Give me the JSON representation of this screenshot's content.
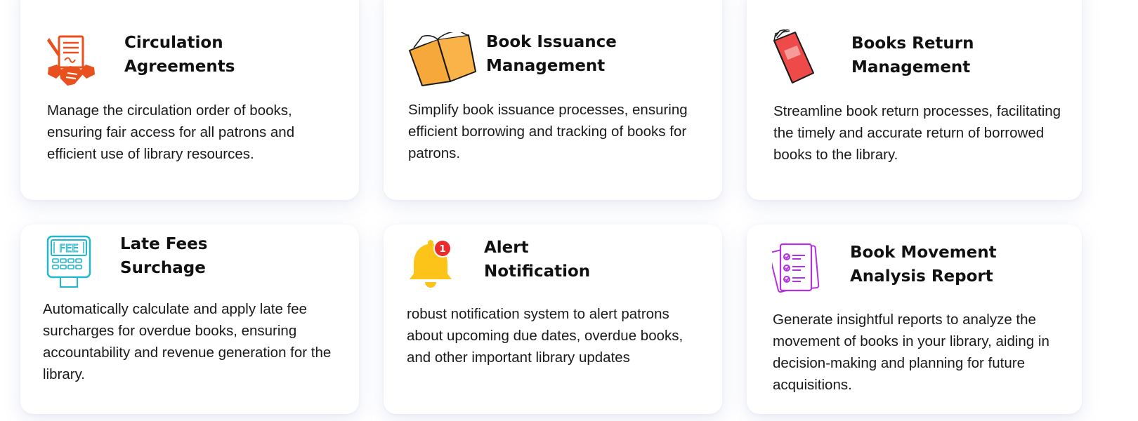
{
  "cards": [
    {
      "title": "Circulation\nAgreements",
      "description": "Manage the circulation order of books, ensuring fair access for all patrons and efficient use of library resources.",
      "icon": "agreement-handshake-icon",
      "icon_color": "#e8501e"
    },
    {
      "title": "Book Issuance\nManagement",
      "description": "Simplify book issuance processes, ensuring efficient borrowing and tracking of books for patrons.",
      "icon": "open-book-icon",
      "icon_color": "#f7a83b"
    },
    {
      "title": "Books Return\nManagement",
      "description": "Streamline book return processes, facilitating the timely and accurate return of borrowed books to the library.",
      "icon": "red-book-icon",
      "icon_color": "#ee4a4a"
    },
    {
      "title": "Late Fees\nSurchage",
      "description": "Automatically calculate and apply late fee surcharges for overdue books, ensuring accountability and revenue generation for the library.",
      "icon": "fee-machine-icon",
      "icon_color": "#23b7cf",
      "icon_label": "FEE"
    },
    {
      "title": "Alert\nNotification",
      "description": "robust notification system to alert patrons about upcoming due dates, overdue books, and other important library updates",
      "icon": "bell-notification-icon",
      "icon_color": "#fcc419",
      "badge_count": "1",
      "badge_color": "#ee2b2b"
    },
    {
      "title": "Book Movement\nAnalysis Report",
      "description": "Generate insightful reports to analyze the movement of books in your library, aiding in decision-making and planning for future acquisitions.",
      "icon": "report-checklist-icon",
      "icon_color": "#b332e0"
    }
  ]
}
